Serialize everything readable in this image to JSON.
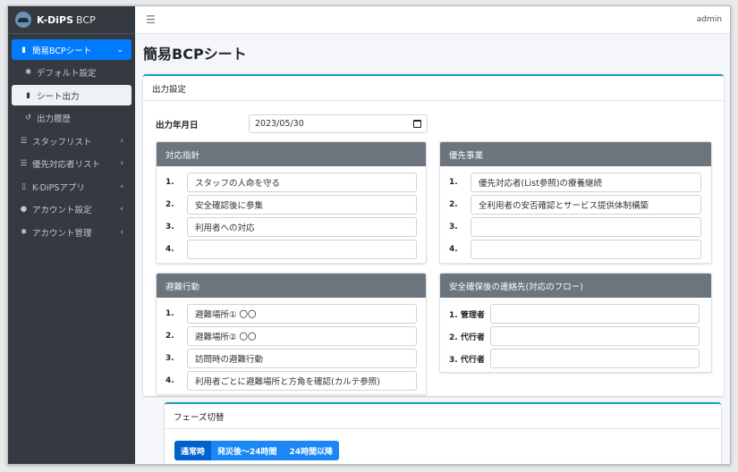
{
  "brand": {
    "name": "K-DiPS",
    "suffix": "BCP"
  },
  "topbar": {
    "menu_icon": "hamburger-icon",
    "user": "admin"
  },
  "sidebar": {
    "items": [
      {
        "label": "簡易BCPシート",
        "icon": "file-icon"
      },
      {
        "label": "デフォルト設定",
        "icon": "gear-icon"
      },
      {
        "label": "シート出力",
        "icon": "file-pdf-icon"
      },
      {
        "label": "出力履歴",
        "icon": "history-icon"
      },
      {
        "label": "スタッフリスト",
        "icon": "list-icon"
      },
      {
        "label": "優先対応者リスト",
        "icon": "list-icon"
      },
      {
        "label": "K-DiPSアプリ",
        "icon": "mobile-icon"
      },
      {
        "label": "アカウント設定",
        "icon": "user-gear-icon"
      },
      {
        "label": "アカウント管理",
        "icon": "gear-icon"
      }
    ]
  },
  "page": {
    "title": "簡易BCPシート"
  },
  "output": {
    "header": "出力設定",
    "date_label": "出力年月日",
    "date_value": "2023/05/30",
    "policy": {
      "title": "対応指針",
      "rows": [
        {
          "num": "1.",
          "value": "スタッフの人命を守る"
        },
        {
          "num": "2.",
          "value": "安全確認後に参集"
        },
        {
          "num": "3.",
          "value": "利用者への対応"
        },
        {
          "num": "4.",
          "value": ""
        }
      ]
    },
    "priority": {
      "title": "優先事業",
      "rows": [
        {
          "num": "1.",
          "value": "優先対応者(List参照)の療養継続"
        },
        {
          "num": "2.",
          "value": "全利用者の安否確認とサービス提供体制構築"
        },
        {
          "num": "3.",
          "value": ""
        },
        {
          "num": "4.",
          "value": ""
        }
      ]
    },
    "evacuation": {
      "title": "避難行動",
      "rows": [
        {
          "num": "1.",
          "value": "避難場所① 〇〇"
        },
        {
          "num": "2.",
          "value": "避難場所② 〇〇"
        },
        {
          "num": "3.",
          "value": "訪問時の避難行動"
        },
        {
          "num": "4.",
          "value": "利用者ごとに避難場所と方角を確認(カルテ参照)"
        }
      ]
    },
    "contact": {
      "title": "安全確保後の連絡先(対応のフロー)",
      "rows": [
        {
          "label": "1. 管理者",
          "value": ""
        },
        {
          "label": "2. 代行者",
          "value": ""
        },
        {
          "label": "3. 代行者",
          "value": ""
        }
      ]
    }
  },
  "phase": {
    "header": "フェーズ切替",
    "tabs": [
      "通常時",
      "発災後〜24時間",
      "24時間以降"
    ]
  },
  "colors": {
    "primary": "#007bff",
    "sidebar": "#343a40",
    "panel_header": "#6c757d",
    "accent": "#17a2b8"
  }
}
